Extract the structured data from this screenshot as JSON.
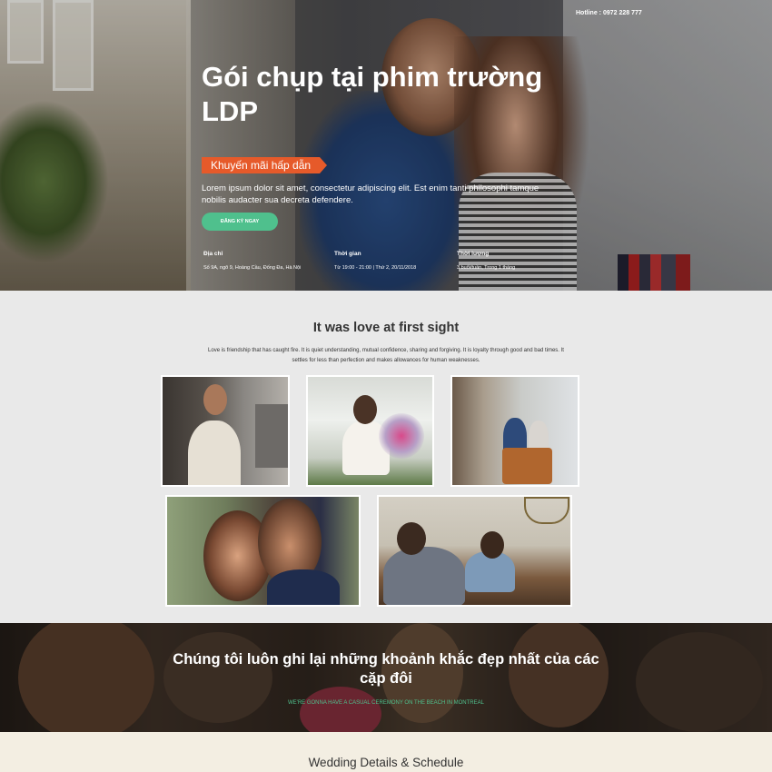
{
  "header": {
    "hotline": "Hotline : 0972 228 777"
  },
  "hero": {
    "title": "Gói chụp tại phim trường LDP",
    "promo_badge": "Khuyến mãi hấp dẫn",
    "description": "Lorem ipsum dolor sit amet, consectetur adipiscing elit. Est enim tanti philosophi tamque nobilis audacter sua decreta defendere.",
    "cta_label": "ĐĂNG KÝ NGAY",
    "info": [
      {
        "label": "Địa chỉ",
        "value": "Số 9A, ngõ 9, Hoàng Cầu,  Đống Đa, Hà Nội"
      },
      {
        "label": "Thời gian",
        "value": "Từ 19:00 - 21:00 |  Thứ 2, 20/11/2018"
      },
      {
        "label": "Thời lượng",
        "value": "3 buổi/tuần, Trong 1 tháng"
      }
    ]
  },
  "love_section": {
    "title": "It was love at first sight",
    "text": "Love is friendship that has caught fire. It is quiet understanding, mutual confidence, sharing and forgiving. It is loyalty through good and bad times. It settles for less than perfection and makes allowances for human weaknesses."
  },
  "moments_section": {
    "title": "Chúng tôi luôn ghi lại những khoảnh khắc đẹp nhất của các cặp đôi",
    "subtitle": "WE'RE GONNA HAVE A CASUAL CEREMONY ON THE BEACH IN MONTREAL"
  },
  "details_section": {
    "title": "Wedding Details & Schedule"
  },
  "colors": {
    "accent_green": "#4fc08d",
    "promo_orange": "#e65a2a"
  }
}
